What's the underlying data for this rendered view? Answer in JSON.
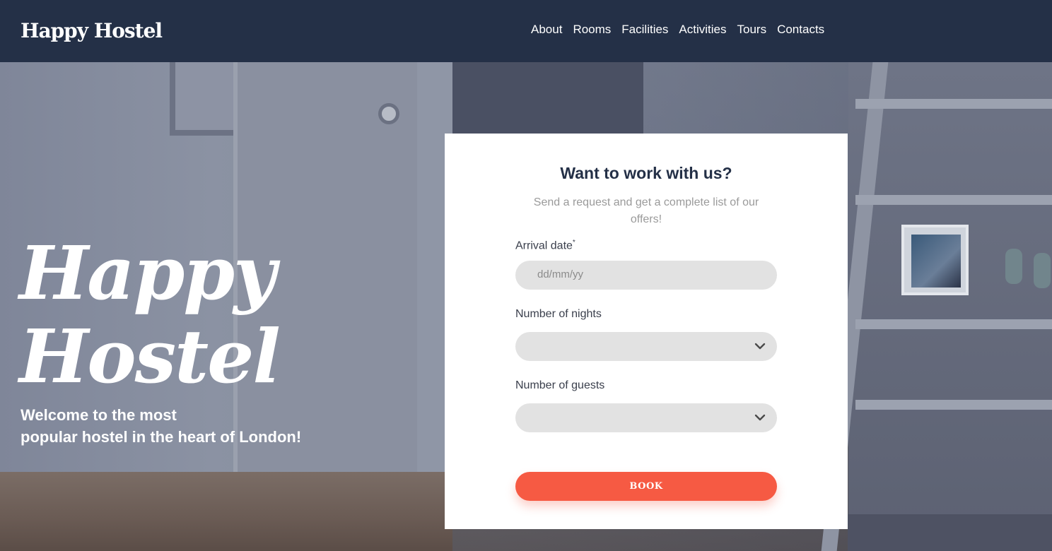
{
  "header": {
    "logo": "Happy Hostel",
    "nav": [
      "About",
      "Rooms",
      "Facilities",
      "Activities",
      "Tours",
      "Contacts"
    ]
  },
  "hero": {
    "title_line1": "Happy",
    "title_line2": "Hostel",
    "subtitle_line1": "Welcome to the most",
    "subtitle_line2": "popular hostel in the heart of London!"
  },
  "form": {
    "title": "Want to work with us?",
    "description": "Send a request and get a complete list of our offers!",
    "arrival_label": "Arrival date",
    "arrival_required_mark": "*",
    "arrival_placeholder": "dd/mm/yy",
    "nights_label": "Number of nights",
    "nights_value": "",
    "guests_label": "Number of guests",
    "guests_value": "",
    "submit_label": "BOOK"
  },
  "colors": {
    "header_bg": "#243047",
    "accent": "#f65a43",
    "field_bg": "#e2e2e2"
  },
  "icons": {
    "select_arrow": "chevron-down-icon"
  }
}
